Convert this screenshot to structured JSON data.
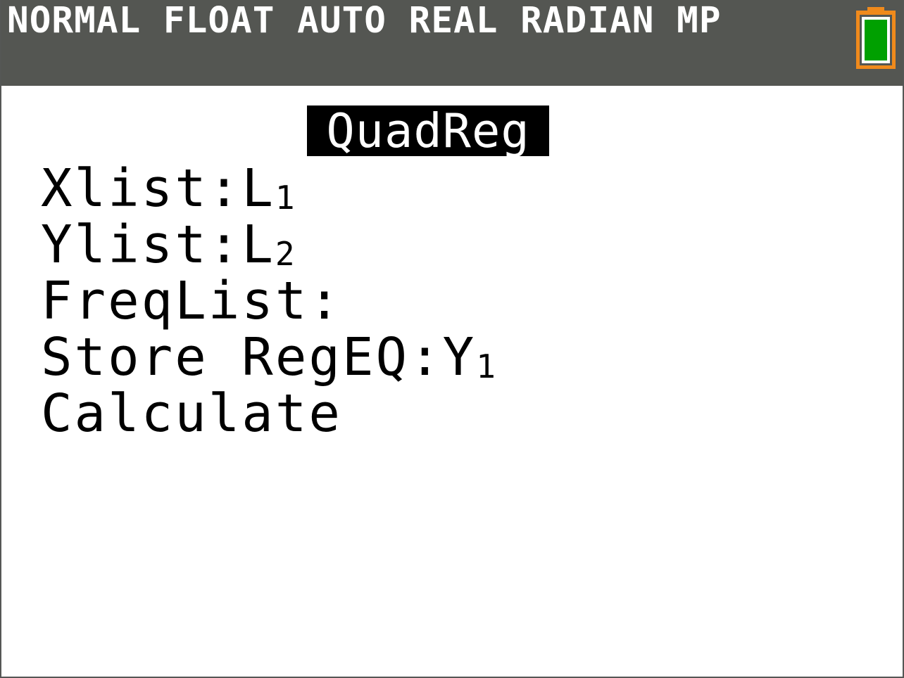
{
  "status_bar": {
    "mode_text": "NORMAL FLOAT AUTO REAL RADIAN MP",
    "battery_icon": "battery-icon",
    "battery_color": "#f08a1c",
    "battery_fill_color": "#00a000",
    "background_color": "#545652"
  },
  "title": "QuadReg",
  "menu": {
    "xlist": {
      "label": "Xlist:",
      "value_main": "L",
      "value_sub": "1"
    },
    "ylist": {
      "label": "Ylist:",
      "value_main": "L",
      "value_sub": "2"
    },
    "freqlist": {
      "label": "FreqList:"
    },
    "store_regeq": {
      "label": "Store RegEQ:",
      "value_main": "Y",
      "value_sub": "1"
    },
    "calculate": {
      "label": "Calculate"
    }
  }
}
